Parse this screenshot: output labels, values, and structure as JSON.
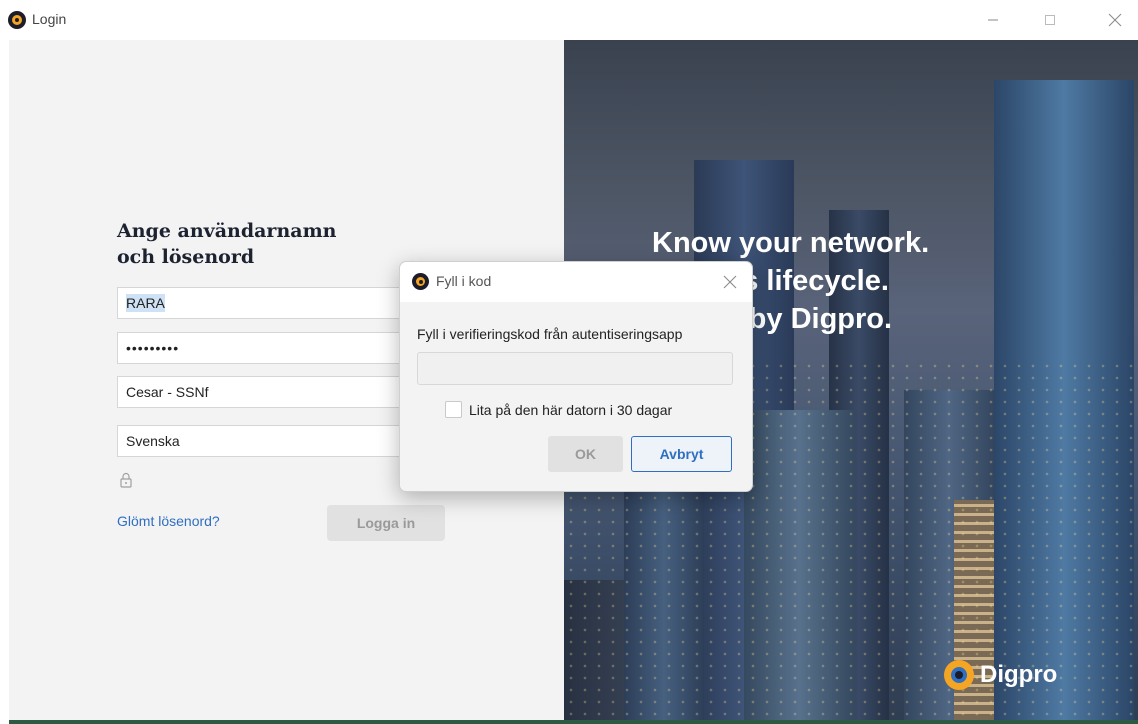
{
  "window": {
    "title": "Login",
    "icon": "digpro-app-icon"
  },
  "login": {
    "heading_line1": "Ange användarnamn",
    "heading_line2": "och lösenord",
    "username_value": "RARA",
    "password_value": "•••••••••",
    "database_value": "Cesar - SSNf",
    "language_value": "Svenska",
    "forgot_password_link": "Glömt lösenord?",
    "login_button": "Logga in",
    "lock_icon": "lock-icon"
  },
  "banner": {
    "headline_line1": "Know your network.",
    "headline_line2": "…gh its lifecycle.",
    "headline_line3": "…ated by Digpro.",
    "brand_name": "Digpro"
  },
  "dialog": {
    "title": "Fyll i kod",
    "instruction": "Fyll i verifieringskod från autentiseringsapp",
    "code_value": "",
    "trust_checkbox_label": "Lita på den här datorn i 30 dagar",
    "trust_checked": false,
    "ok_button": "OK",
    "cancel_button": "Avbryt"
  },
  "colors": {
    "accent": "#2f6fc0",
    "brand_orange": "#f5a524",
    "panel_bg": "#f3f3f3",
    "bottom_strip": "#2e5a44"
  }
}
